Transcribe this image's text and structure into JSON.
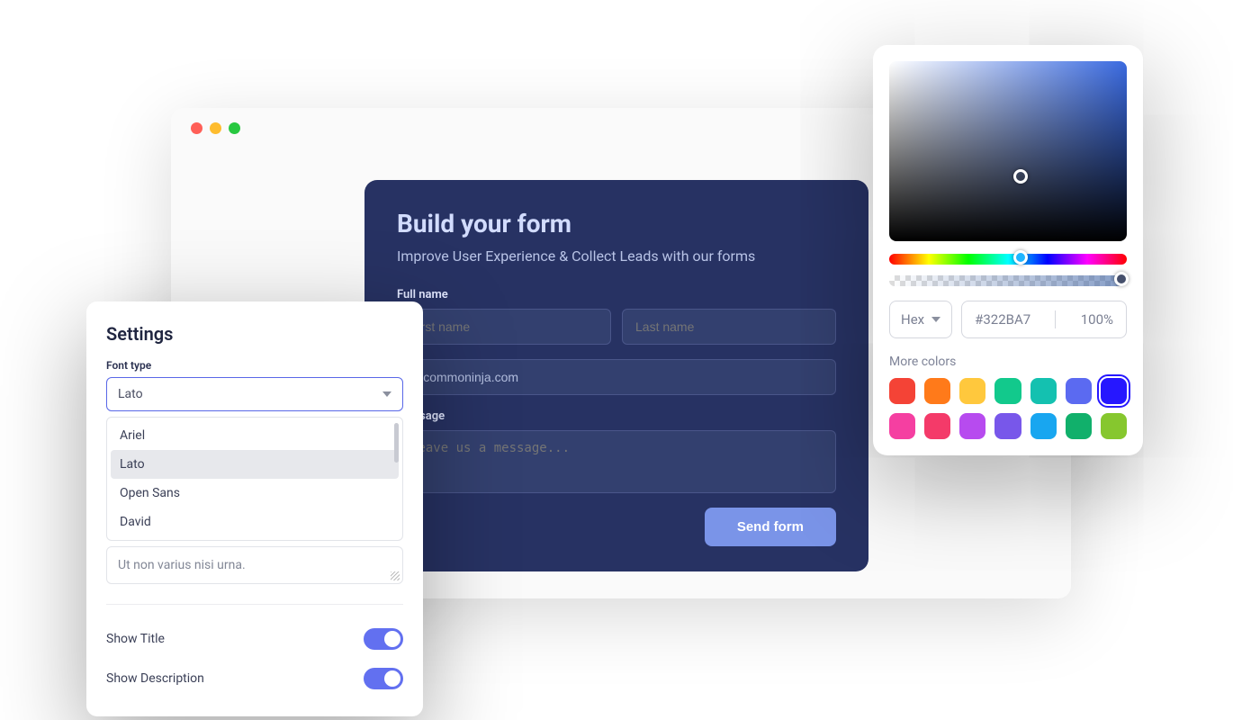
{
  "form": {
    "title": "Build your form",
    "subtitle": "Improve User Experience & Collect Leads with our forms",
    "fullname_label": "Full name",
    "firstname_placeholder": "First name",
    "lastname_placeholder": "Last name",
    "email_value": "@commoninja.com",
    "message_label": "Message",
    "message_placeholder": "Leave us a message...",
    "submit_label": "Send form"
  },
  "settings": {
    "title": "Settings",
    "font_label": "Font type",
    "font_selected": "Lato",
    "font_options": [
      "Ariel",
      "Lato",
      "Open Sans",
      "David"
    ],
    "ghost_text": "Ut non varius nisi urna.",
    "toggle_title": "Show Title",
    "toggle_desc": "Show Description",
    "toggle_title_on": true,
    "toggle_desc_on": true
  },
  "picker": {
    "mode": "Hex",
    "hex": "#322BA7",
    "opacity": "100%",
    "more_label": "More colors",
    "swatches": [
      "#F44336",
      "#FF7A1A",
      "#FFC83D",
      "#12C98C",
      "#14C1B0",
      "#5B6AF1",
      "#2617FF",
      "#F53FA1",
      "#F43A69",
      "#B74BEF",
      "#7857EA",
      "#18A6F0",
      "#11B06B",
      "#86C72E"
    ],
    "selected_swatch_index": 6
  }
}
